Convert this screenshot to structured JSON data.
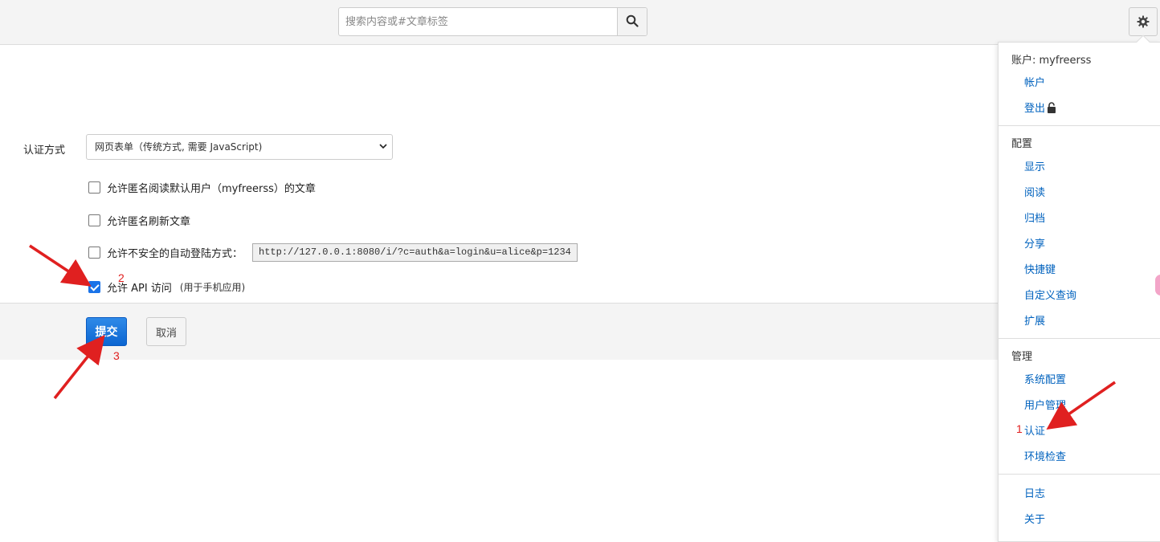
{
  "header": {
    "search_placeholder": "搜索内容或#文章标签"
  },
  "form": {
    "auth_label": "认证方式",
    "auth_select_value": "网页表单（传统方式, 需要 JavaScript)",
    "checks": [
      {
        "label": "允许匿名阅读默认用户（myfreerss）的文章",
        "checked": false
      },
      {
        "label": "允许匿名刷新文章",
        "checked": false
      },
      {
        "label": "允许不安全的自动登陆方式：",
        "checked": false,
        "url": "http://127.0.0.1:8080/i/?c=auth&a=login&u=alice&p=1234"
      },
      {
        "label": "允许 API 访问",
        "checked": true,
        "hint": "(用于手机应用)"
      }
    ],
    "submit_label": "提交",
    "cancel_label": "取消"
  },
  "menu": {
    "account_head": "账户: myfreerss",
    "account_items": [
      "帐户",
      "登出"
    ],
    "config_head": "配置",
    "config_items": [
      "显示",
      "阅读",
      "归档",
      "分享",
      "快捷键",
      "自定义查询",
      "扩展"
    ],
    "admin_head": "管理",
    "admin_items": [
      "系统配置",
      "用户管理",
      "认证",
      "环境检查"
    ],
    "misc_items": [
      "日志",
      "关于"
    ]
  },
  "annotations": [
    "1",
    "2",
    "3"
  ],
  "colors": {
    "link": "#0062be",
    "primary": "#0b65d1",
    "annotation": "#e02020"
  }
}
